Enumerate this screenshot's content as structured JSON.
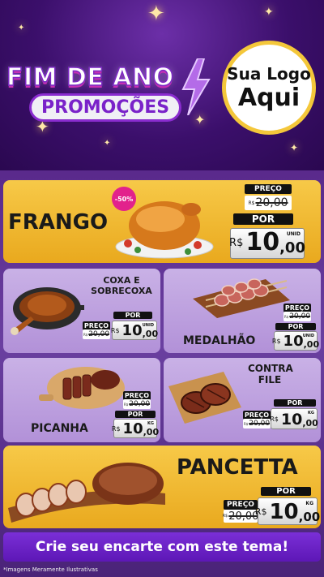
{
  "header": {
    "title_line1": "FIM DE ANO",
    "title_line2": "PROMOÇÕES",
    "logo_line1": "Sua Logo",
    "logo_line2": "Aqui"
  },
  "labels": {
    "preco": "PREÇO",
    "por": "POR",
    "currency": "R$"
  },
  "products": [
    {
      "name": "FRANGO",
      "old_price": "20,00",
      "price_int": "10",
      "price_dec": ",00",
      "unit": "UNID",
      "discount": "-50%"
    },
    {
      "name_line1": "COXA E",
      "name_line2": "SOBRECOXA",
      "old_price": "20,00",
      "price_int": "10",
      "price_dec": ",00",
      "unit": "UNID"
    },
    {
      "name": "MEDALHÃO",
      "old_price": "20,00",
      "price_int": "10",
      "price_dec": ",00",
      "unit": "UNID"
    },
    {
      "name": "PICANHA",
      "old_price": "20,00",
      "price_int": "10",
      "price_dec": ",00",
      "unit": "KG"
    },
    {
      "name_line1": "CONTRA",
      "name_line2": "FILE",
      "old_price": "20,00",
      "price_int": "10",
      "price_dec": ",00",
      "unit": "KG"
    },
    {
      "name": "PANCETTA",
      "old_price": "20,00",
      "price_int": "10",
      "price_dec": ",00",
      "unit": "KG"
    }
  ],
  "cta": "Crie seu encarte com este tema!",
  "footer": "*Imagens Meramente Ilustrativas"
}
